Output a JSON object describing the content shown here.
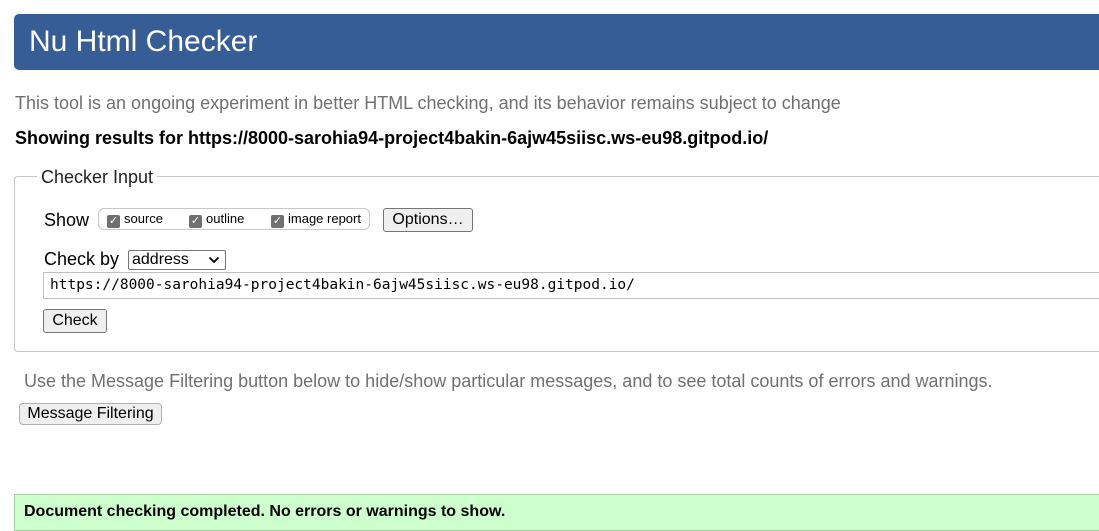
{
  "header": {
    "title": "Nu Html Checker"
  },
  "intro": {
    "text": "This tool is an ongoing experiment in better HTML checking, and its behavior remains subject to change"
  },
  "results": {
    "heading": "Showing results for https://8000-sarohia94-project4bakin-6ajw45siisc.ws-eu98.gitpod.io/"
  },
  "checker_input": {
    "legend": "Checker Input",
    "show_label": "Show",
    "show_options": [
      {
        "label": "source",
        "checked": true
      },
      {
        "label": "outline",
        "checked": true
      },
      {
        "label": "image report",
        "checked": true
      }
    ],
    "options_button": "Options…",
    "check_by_label": "Check by",
    "check_by_selected": "address",
    "url_value": "https://8000-sarohia94-project4bakin-6ajw45siisc.ws-eu98.gitpod.io/",
    "check_button": "Check"
  },
  "filtering": {
    "text": "Use the Message Filtering button below to hide/show particular messages, and to see total counts of errors and warnings.",
    "button": "Message Filtering"
  },
  "status": {
    "message": "Document checking completed. No errors or warnings to show."
  }
}
